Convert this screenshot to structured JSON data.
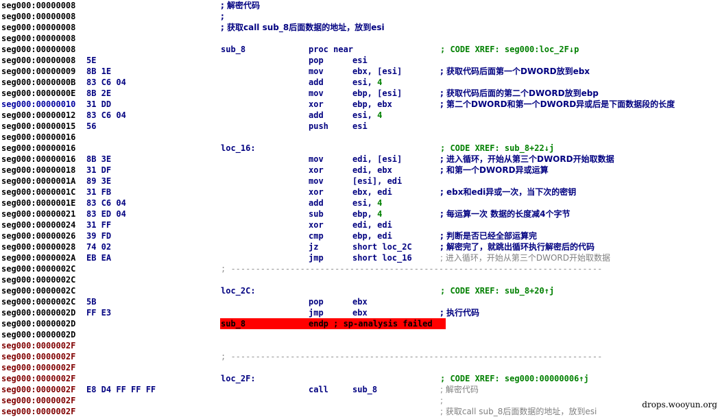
{
  "watermark": "drops.wooyun.org",
  "colors": {
    "address_default": "#000000",
    "address_blue": "#0000a0",
    "address_maroon": "#800000",
    "instruction": "#000080",
    "xref_comment": "#008000",
    "immediate_number": "#008000",
    "faded_comment": "#808080",
    "endp_highlight": "#ff0000"
  },
  "lines": [
    {
      "addr": "seg000:00000008",
      "ac": "",
      "comment": "; 解密代码",
      "cfull": true
    },
    {
      "addr": "seg000:00000008",
      "ac": "",
      "comment": ";",
      "cfull": true
    },
    {
      "addr": "seg000:00000008",
      "ac": "",
      "comment": "; 获取call sub_8后面数据的地址，放到esi",
      "cfull": true
    },
    {
      "addr": "seg000:00000008",
      "ac": ""
    },
    {
      "addr": "seg000:00000008",
      "ac": "",
      "label": "sub_8",
      "mnem": "proc near",
      "comment": "; CODE XREF: seg000:loc_2F↓p",
      "ctype": "xref"
    },
    {
      "addr": "seg000:00000008",
      "ac": "",
      "bytes": "5E",
      "mnem": "pop",
      "ops": "esi"
    },
    {
      "addr": "seg000:00000009",
      "ac": "",
      "bytes": "8B 1E",
      "mnem": "mov",
      "ops": "ebx, [esi]",
      "comment": "; 获取代码后面第一个DWORD放到ebx"
    },
    {
      "addr": "seg000:0000000B",
      "ac": "",
      "bytes": "83 C6 04",
      "mnem": "add",
      "ops": "esi, ",
      "num": "4"
    },
    {
      "addr": "seg000:0000000E",
      "ac": "",
      "bytes": "8B 2E",
      "mnem": "mov",
      "ops": "ebp, [esi]",
      "comment": "; 获取代码后面的第二个DWORD放到ebp"
    },
    {
      "addr": "seg000:00000010",
      "ac": "blue",
      "bytes": "31 DD",
      "mnem": "xor",
      "ops": "ebp, ebx",
      "comment": "; 第二个DWORD和第一个DWORD异或后是下面数据段的长度"
    },
    {
      "addr": "seg000:00000012",
      "ac": "",
      "bytes": "83 C6 04",
      "mnem": "add",
      "ops": "esi, ",
      "num": "4"
    },
    {
      "addr": "seg000:00000015",
      "ac": "",
      "bytes": "56",
      "mnem": "push",
      "ops": "esi"
    },
    {
      "addr": "seg000:00000016",
      "ac": ""
    },
    {
      "addr": "seg000:00000016",
      "ac": "",
      "label": "loc_16:",
      "comment": "; CODE XREF: sub_8+22↓j",
      "ctype": "xref"
    },
    {
      "addr": "seg000:00000016",
      "ac": "",
      "bytes": "8B 3E",
      "mnem": "mov",
      "ops": "edi, [esi]",
      "comment": "; 进入循环，开始从第三个DWORD开始取数据"
    },
    {
      "addr": "seg000:00000018",
      "ac": "",
      "bytes": "31 DF",
      "mnem": "xor",
      "ops": "edi, ebx",
      "comment": "; 和第一个DWORD异或运算"
    },
    {
      "addr": "seg000:0000001A",
      "ac": "",
      "bytes": "89 3E",
      "mnem": "mov",
      "ops": "[esi], edi"
    },
    {
      "addr": "seg000:0000001C",
      "ac": "",
      "bytes": "31 FB",
      "mnem": "xor",
      "ops": "ebx, edi",
      "comment": "; ebx和edi异或一次，当下次的密钥"
    },
    {
      "addr": "seg000:0000001E",
      "ac": "",
      "bytes": "83 C6 04",
      "mnem": "add",
      "ops": "esi, ",
      "num": "4"
    },
    {
      "addr": "seg000:00000021",
      "ac": "",
      "bytes": "83 ED 04",
      "mnem": "sub",
      "ops": "ebp, ",
      "num": "4",
      "comment": "; 每运算一次 数据的长度减4个字节"
    },
    {
      "addr": "seg000:00000024",
      "ac": "",
      "bytes": "31 FF",
      "mnem": "xor",
      "ops": "edi, edi"
    },
    {
      "addr": "seg000:00000026",
      "ac": "",
      "bytes": "39 FD",
      "mnem": "cmp",
      "ops": "ebp, edi",
      "comment": "; 判断是否已经全部运算完"
    },
    {
      "addr": "seg000:00000028",
      "ac": "",
      "bytes": "74 02",
      "mnem": "jz",
      "ops": "short loc_2C",
      "comment": "; 解密完了，就跳出循环执行解密后的代码"
    },
    {
      "addr": "seg000:0000002A",
      "ac": "",
      "bytes": "EB EA",
      "mnem": "jmp",
      "ops": "short loc_16",
      "comment": "; 进入循环，开始从第三个DWORD开始取数据",
      "ctype": "gray"
    },
    {
      "addr": "seg000:0000002C",
      "ac": "",
      "sep": "; ---------------------------------------------------------------------------"
    },
    {
      "addr": "seg000:0000002C",
      "ac": ""
    },
    {
      "addr": "seg000:0000002C",
      "ac": "",
      "label": "loc_2C:",
      "comment": "; CODE XREF: sub_8+20↑j",
      "ctype": "xref"
    },
    {
      "addr": "seg000:0000002C",
      "ac": "",
      "bytes": "5B",
      "mnem": "pop",
      "ops": "ebx"
    },
    {
      "addr": "seg000:0000002D",
      "ac": "",
      "bytes": "FF E3",
      "mnem": "jmp",
      "ops": "ebx",
      "comment": "; 执行代码"
    },
    {
      "addr": "seg000:0000002D",
      "ac": "",
      "label": "sub_8",
      "mnem": "endp ; sp-analysis failed",
      "highlight": true
    },
    {
      "addr": "seg000:0000002D",
      "ac": ""
    },
    {
      "addr": "seg000:0000002F",
      "ac": "maroon"
    },
    {
      "addr": "seg000:0000002F",
      "ac": "maroon",
      "sep": "; ---------------------------------------------------------------------------"
    },
    {
      "addr": "seg000:0000002F",
      "ac": "maroon"
    },
    {
      "addr": "seg000:0000002F",
      "ac": "maroon",
      "label": "loc_2F:",
      "comment": "; CODE XREF: seg000:00000006↑j",
      "ctype": "xref"
    },
    {
      "addr": "seg000:0000002F",
      "ac": "maroon",
      "bytes": "E8 D4 FF FF FF",
      "mnem": "call",
      "ops": "sub_8",
      "comment": "; 解密代码",
      "ctype": "gray"
    },
    {
      "addr": "seg000:0000002F",
      "ac": "maroon",
      "comment": ";",
      "ctype": "gray"
    },
    {
      "addr": "seg000:0000002F",
      "ac": "maroon",
      "comment": "; 获取call sub_8后面数据的地址，放到esi",
      "ctype": "gray"
    }
  ]
}
